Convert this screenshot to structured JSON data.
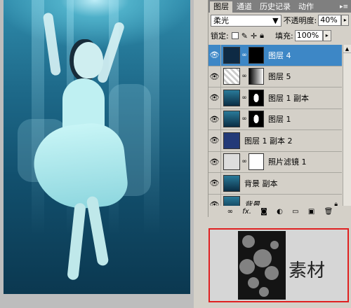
{
  "layers_panel": {
    "tabs": [
      {
        "label": "图层"
      },
      {
        "label": "通道"
      },
      {
        "label": "历史记录"
      },
      {
        "label": "动作"
      }
    ],
    "blend_mode": "柔光",
    "opacity_label": "不透明度:",
    "opacity_value": "40%",
    "lock_label": "锁定:",
    "fill_label": "填充:",
    "fill_value": "100%",
    "layers": [
      {
        "name": "图层 4",
        "selected": true
      },
      {
        "name": "图层 5",
        "selected": false
      },
      {
        "name": "图层 1 副本",
        "selected": false
      },
      {
        "name": "图层 1",
        "selected": false
      },
      {
        "name": "图层 1 副本 2",
        "selected": false
      },
      {
        "name": "照片滤镜 1",
        "selected": false
      },
      {
        "name": "背景 副本",
        "selected": false
      },
      {
        "name": "背景",
        "selected": false
      }
    ],
    "bottom_icons": [
      "link-icon",
      "fx-icon",
      "mask-icon",
      "adjustment-icon",
      "group-icon",
      "new-layer-icon",
      "trash-icon"
    ]
  },
  "material": {
    "label": "素材"
  },
  "colors": {
    "selected_layer": "#3d87c6",
    "material_border": "#e02020"
  }
}
